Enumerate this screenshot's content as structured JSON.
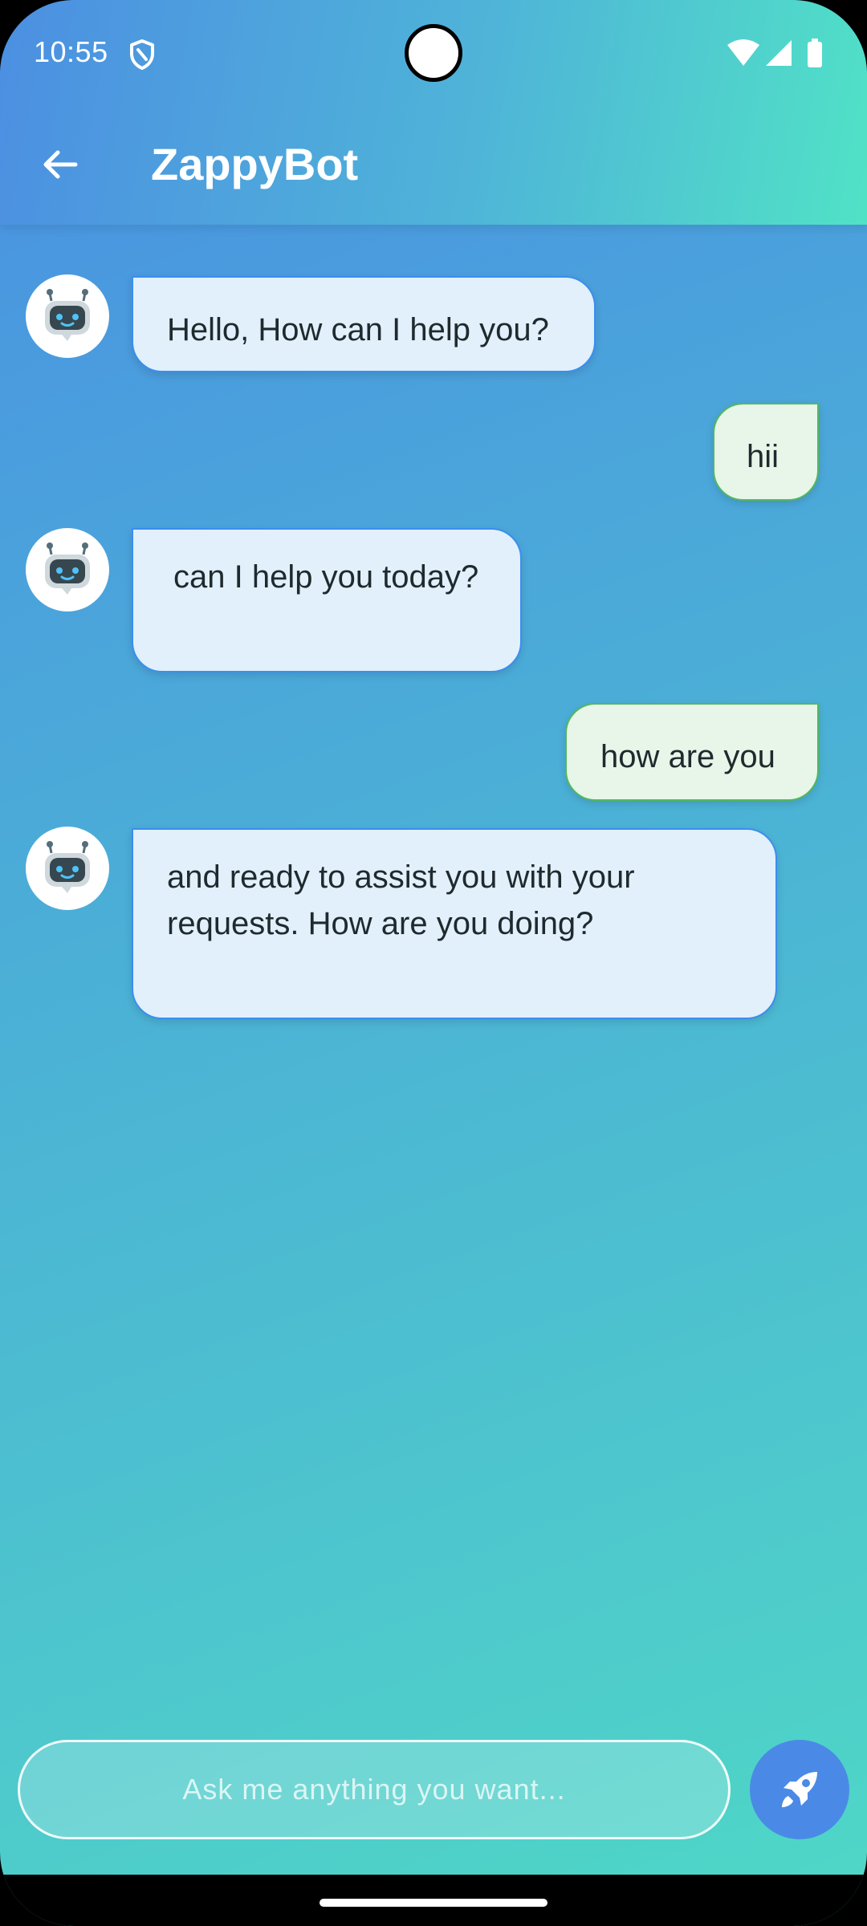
{
  "status_bar": {
    "time": "10:55",
    "shield_icon": "shield-icon",
    "wifi_icon": "wifi-icon",
    "signal_icon": "cell-signal-icon",
    "battery_icon": "battery-icon"
  },
  "app_bar": {
    "title": "ZappyBot",
    "back_icon": "arrow-back-icon"
  },
  "messages": [
    {
      "sender": "bot",
      "text": "Hello, How can I help you?"
    },
    {
      "sender": "user",
      "text": "hii"
    },
    {
      "sender": "bot",
      "text": "can I help you today?"
    },
    {
      "sender": "user",
      "text": "how are you"
    },
    {
      "sender": "bot",
      "text": "and ready to assist you with your requests. How are you doing?"
    }
  ],
  "composer": {
    "placeholder": "Ask me anything you want...",
    "value": "",
    "send_icon": "rocket-icon"
  },
  "colors": {
    "gradient_start": "#4a8fe3",
    "gradient_end": "#4fd8c6",
    "bot_bubble": "#e2f0fc",
    "bot_border": "#3a8ef0",
    "user_bubble": "#e7f6e9",
    "user_border": "#54b75e",
    "send_button": "#4a8ae6"
  }
}
